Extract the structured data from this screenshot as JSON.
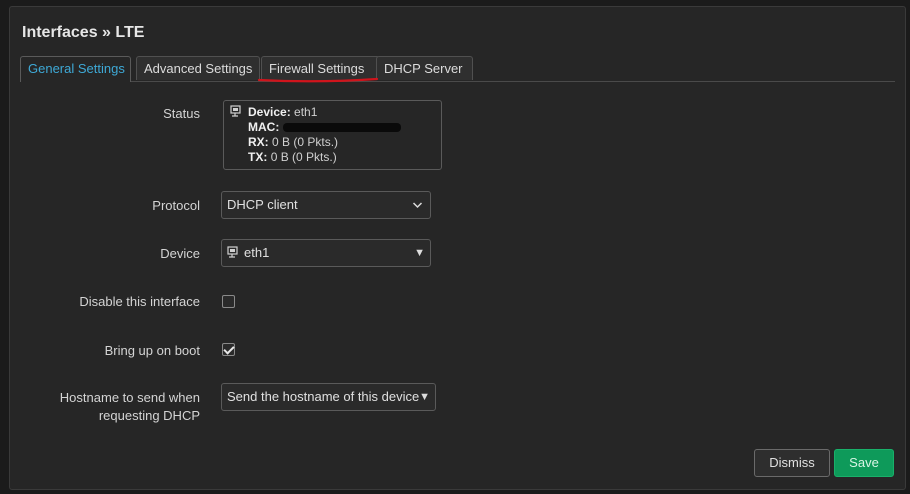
{
  "modal": {
    "title": "Interfaces » LTE"
  },
  "tabs": [
    {
      "label": "General Settings",
      "active": true
    },
    {
      "label": "Advanced Settings",
      "active": false
    },
    {
      "label": "Firewall Settings",
      "active": false
    },
    {
      "label": "DHCP Server",
      "active": false
    }
  ],
  "status": {
    "label": "Status",
    "device_key": "Device:",
    "device_value": "eth1",
    "mac_key": "MAC:",
    "rx_key": "RX:",
    "rx_value": "0 B (0 Pkts.)",
    "tx_key": "TX:",
    "tx_value": "0 B (0 Pkts.)"
  },
  "protocol": {
    "label": "Protocol",
    "value": "DHCP client"
  },
  "device": {
    "label": "Device",
    "value": "eth1"
  },
  "disable_interface": {
    "label": "Disable this interface",
    "checked": false
  },
  "bring_up_on_boot": {
    "label": "Bring up on boot",
    "checked": true
  },
  "hostname": {
    "label_line1": "Hostname to send when",
    "label_line2": "requesting DHCP",
    "value": "Send the hostname of this device"
  },
  "buttons": {
    "dismiss": "Dismiss",
    "save": "Save"
  },
  "colors": {
    "accent": "#3ea9d6",
    "save": "#0e9a5a",
    "annotation": "#d0141c"
  },
  "icons": {
    "device": "network-port-icon",
    "chevron": "chevron-down-icon",
    "caret": "caret-down-icon"
  }
}
